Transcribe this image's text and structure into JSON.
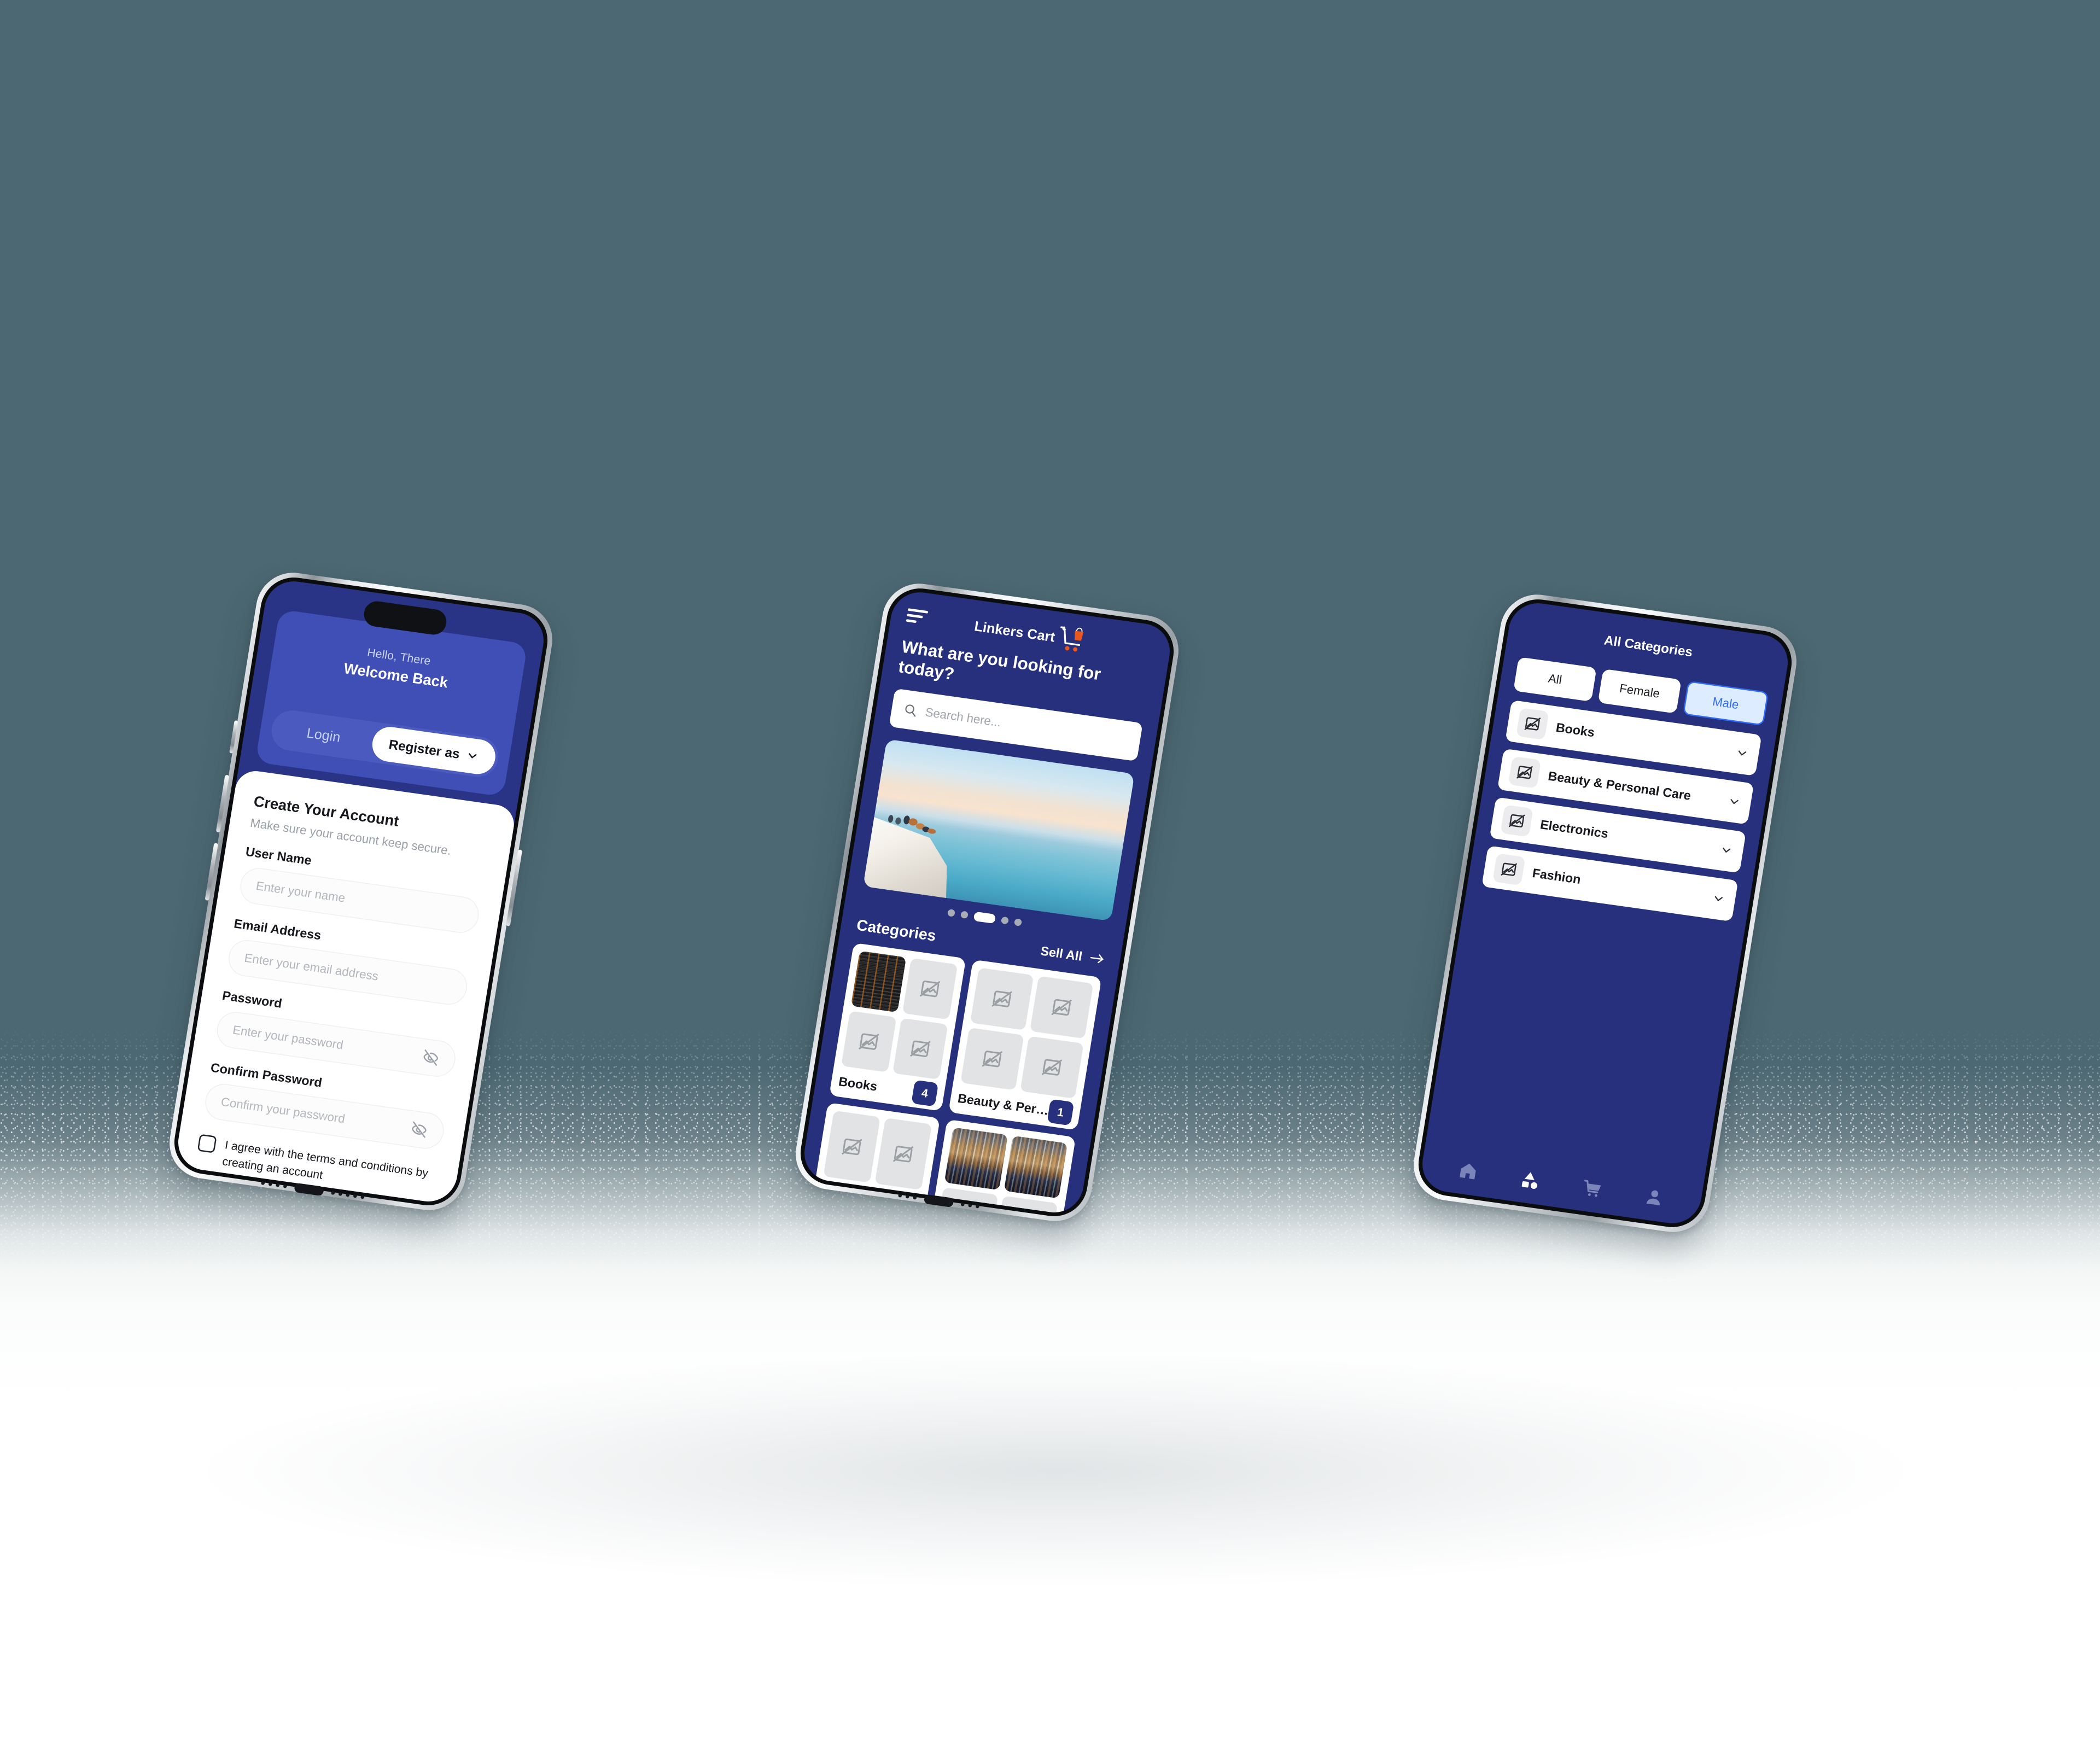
{
  "colors": {
    "background": "#4c6872",
    "navy": "#26307c",
    "navy_light": "#3f4fb5",
    "accent_orange": "#e8571f",
    "chip_selected_bg": "#deecff",
    "chip_selected_border": "#2f6bf5"
  },
  "phone1": {
    "name": "signup-screen",
    "hero": {
      "greeting": "Hello, There",
      "welcome": "Welcome Back",
      "login_label": "Login",
      "register_label": "Register as"
    },
    "form": {
      "title": "Create Your Account",
      "subtitle": "Make sure your account keep secure.",
      "fields": [
        {
          "label": "User Name",
          "placeholder": "Enter your name",
          "has_eye": false
        },
        {
          "label": "Email Address",
          "placeholder": "Enter your email address",
          "has_eye": false
        },
        {
          "label": "Password",
          "placeholder": "Enter your password",
          "has_eye": true
        },
        {
          "label": "Confirm Password",
          "placeholder": "Confirm your password",
          "has_eye": true
        }
      ],
      "terms_text": "I agree with the terms and conditions by creating an account",
      "terms_checked": false
    }
  },
  "phone2": {
    "name": "home-screen",
    "brand": "Linkers Cart",
    "headline": "What are you looking for today?",
    "search_placeholder": "Search here...",
    "carousel": {
      "slides": 5,
      "active_index": 2
    },
    "categories_title": "Categories",
    "see_all_label": "Sell All",
    "category_cards": [
      {
        "name": "Books",
        "count": "4"
      },
      {
        "name": "Beauty & Per…",
        "count": "1"
      },
      {
        "name": "",
        "count": ""
      },
      {
        "name": "",
        "count": ""
      }
    ],
    "nav": [
      {
        "icon": "home-icon",
        "active": true
      },
      {
        "icon": "categories-icon",
        "active": false
      },
      {
        "icon": "cart-icon",
        "active": false
      },
      {
        "icon": "profile-icon",
        "active": false
      }
    ]
  },
  "phone3": {
    "name": "all-categories-screen",
    "title": "All Categories",
    "filters": [
      {
        "label": "All",
        "selected": false
      },
      {
        "label": "Female",
        "selected": false
      },
      {
        "label": "Male",
        "selected": true
      }
    ],
    "rows": [
      {
        "label": "Books"
      },
      {
        "label": "Beauty & Personal Care"
      },
      {
        "label": "Electronics"
      },
      {
        "label": "Fashion"
      }
    ],
    "nav": [
      {
        "icon": "home-icon",
        "active": false
      },
      {
        "icon": "categories-icon",
        "active": true
      },
      {
        "icon": "cart-icon",
        "active": false
      },
      {
        "icon": "profile-icon",
        "active": false
      }
    ]
  }
}
